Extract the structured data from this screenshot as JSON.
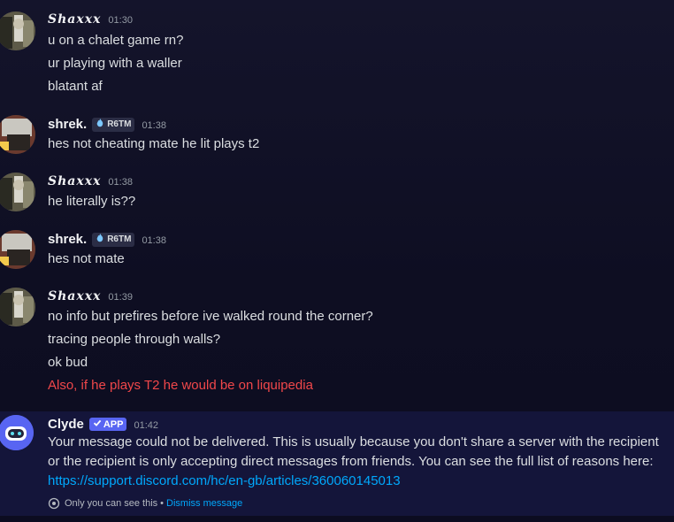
{
  "messages": [
    {
      "author": "Shaxxx",
      "time": "01:30",
      "lines": [
        "u on a chalet game rn?",
        "ur playing with a waller",
        "blatant af"
      ]
    },
    {
      "author": "shrek.",
      "tag": "R6TM",
      "time": "01:38",
      "lines": [
        "hes not cheating mate he lit plays t2"
      ]
    },
    {
      "author": "Shaxxx",
      "time": "01:38",
      "lines": [
        "he literally is??"
      ]
    },
    {
      "author": "shrek.",
      "tag": "R6TM",
      "time": "01:38",
      "lines": [
        "hes not mate"
      ]
    },
    {
      "author": "Shaxxx",
      "time": "01:39",
      "lines": [
        "no info but prefires before ive walked round the corner?",
        "tracing people through walls?",
        "ok bud",
        "Also, if he plays T2 he would be on liquipedia"
      ]
    }
  ],
  "clyde": {
    "author": "Clyde",
    "badge": "APP",
    "time": "01:42",
    "text": "Your message could not be delivered. This is usually because you don't share a server with the recipient or the recipient is only accepting direct messages from friends. You can see the full list of reasons here:",
    "link": "https://support.discord.com/hc/en-gb/articles/360060145013",
    "ephemeral_note": "Only you can see this",
    "separator": "•",
    "dismiss": "Dismiss message"
  },
  "colors": {
    "failed_message": "#f0474a",
    "link": "#00a8fc",
    "app_badge": "#5865f2"
  }
}
